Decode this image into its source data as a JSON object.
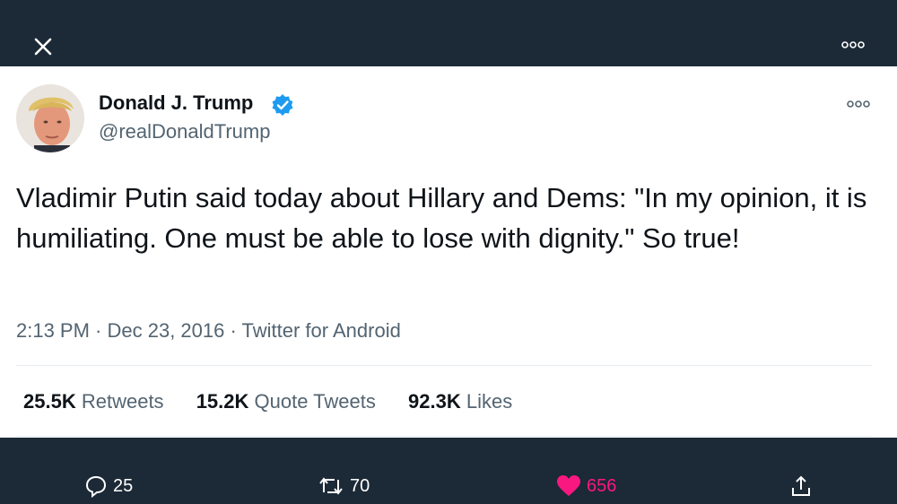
{
  "author": {
    "name": "Donald J. Trump",
    "handle": "@realDonaldTrump"
  },
  "tweet": {
    "text": "Vladimir Putin said today about Hillary and Dems: \"In my opinion, it is humiliating. One must be able to lose with dignity.\" So true!",
    "time": "2:13 PM",
    "separator": " · ",
    "date": "Dec 23, 2016",
    "source": "Twitter for Android"
  },
  "stats": [
    {
      "count": "25.5K",
      "label": "Retweets"
    },
    {
      "count": "15.2K",
      "label": "Quote Tweets"
    },
    {
      "count": "92.3K",
      "label": "Likes"
    }
  ],
  "actions": {
    "reply_count": "25",
    "retweet_count": "70",
    "like_count": "656"
  },
  "icons": {
    "close": "close-icon",
    "more": "more-icon",
    "verified": "verified-badge-icon",
    "reply": "reply-icon",
    "retweet": "retweet-icon",
    "like": "heart-icon",
    "share": "share-icon"
  },
  "colors": {
    "background": "#1c2936",
    "verified": "#1d9bf0",
    "like": "#f91880",
    "secondary_text": "#536471"
  }
}
